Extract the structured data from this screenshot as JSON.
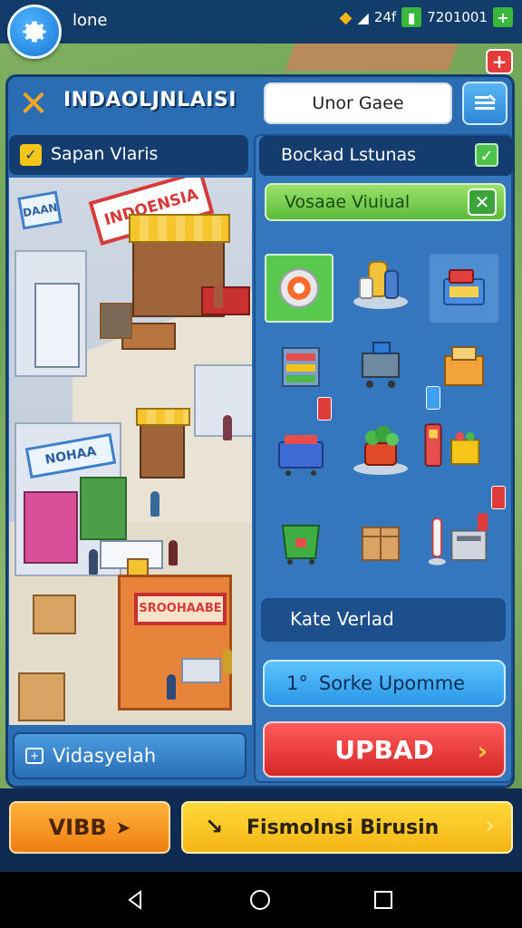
{
  "status_bar": {
    "label": "lone",
    "right_text_1": "24f",
    "right_text_2": "7201001",
    "plus": "+"
  },
  "header": {
    "title": "INDAOLJNLAISI",
    "search_value": "Unor Gaee"
  },
  "left_panel": {
    "bar_label": "Sapan Vlaris",
    "scene_signs": {
      "main": "INDOENSIA",
      "blue": "NOHAA",
      "orange": "SROOHAABE",
      "small": "DAAN"
    },
    "footer_button": "Vidasyelah"
  },
  "right_panel": {
    "bar_label": "Bockad Lstunas",
    "green_label": "Vosaae Viuiual",
    "kate_label": "Kate Verlad",
    "update_label": "Sorke Upomme",
    "update_prefix": "1°",
    "red_button": "UPBAD"
  },
  "bottom": {
    "left_button": "VIBB",
    "right_button": "Fismolnsi Birusin"
  },
  "icons": [
    "gear-icon",
    "edit-icon",
    "close-icon",
    "check-icon",
    "arrow-icon",
    "back-icon",
    "home-icon",
    "recents-icon"
  ],
  "colors": {
    "panel": "#2a6db2",
    "dark": "#143c6e",
    "green": "#5dbb3a",
    "red": "#d62828",
    "orange": "#f07e13",
    "yellow": "#f5b515"
  }
}
